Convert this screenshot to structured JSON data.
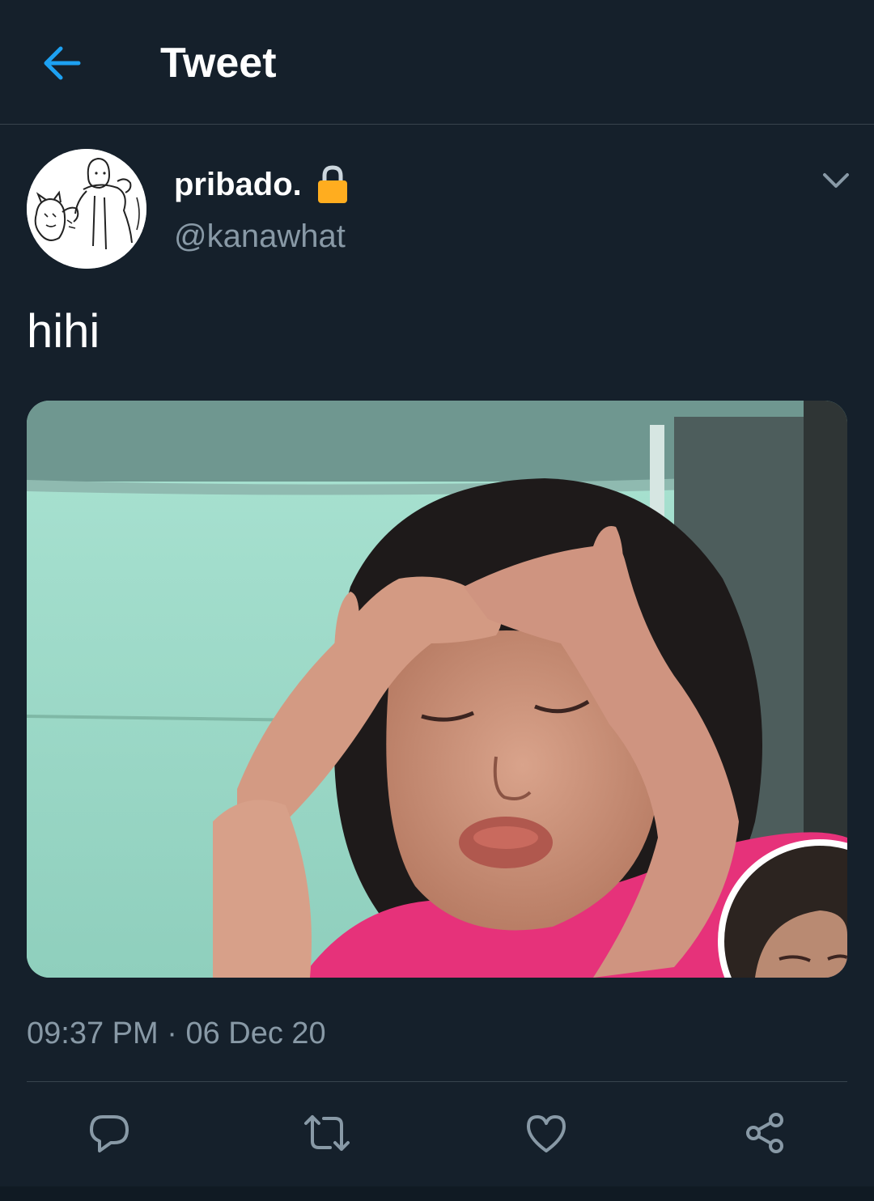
{
  "header": {
    "back_icon": "arrow-left-icon",
    "title": "Tweet"
  },
  "tweet": {
    "author": {
      "display_name": "pribado.",
      "handle": "@kanawhat",
      "protected_icon": "lock-icon",
      "avatar": "cartoon-avatar"
    },
    "menu_icon": "chevron-down-icon",
    "text": "hihi",
    "media": {
      "type": "image",
      "icon": "photo"
    },
    "time": "09:37 PM",
    "separator": "·",
    "date": "06 Dec 20",
    "actions": [
      {
        "name": "reply",
        "icon": "reply-icon"
      },
      {
        "name": "retweet",
        "icon": "retweet-icon"
      },
      {
        "name": "like",
        "icon": "heart-icon"
      },
      {
        "name": "share",
        "icon": "share-icon"
      }
    ]
  },
  "colors": {
    "background": "#15202b",
    "accent": "#1da1f2",
    "secondary_text": "#8899a6",
    "divider": "#38444d",
    "lock": "#ffad1f"
  }
}
